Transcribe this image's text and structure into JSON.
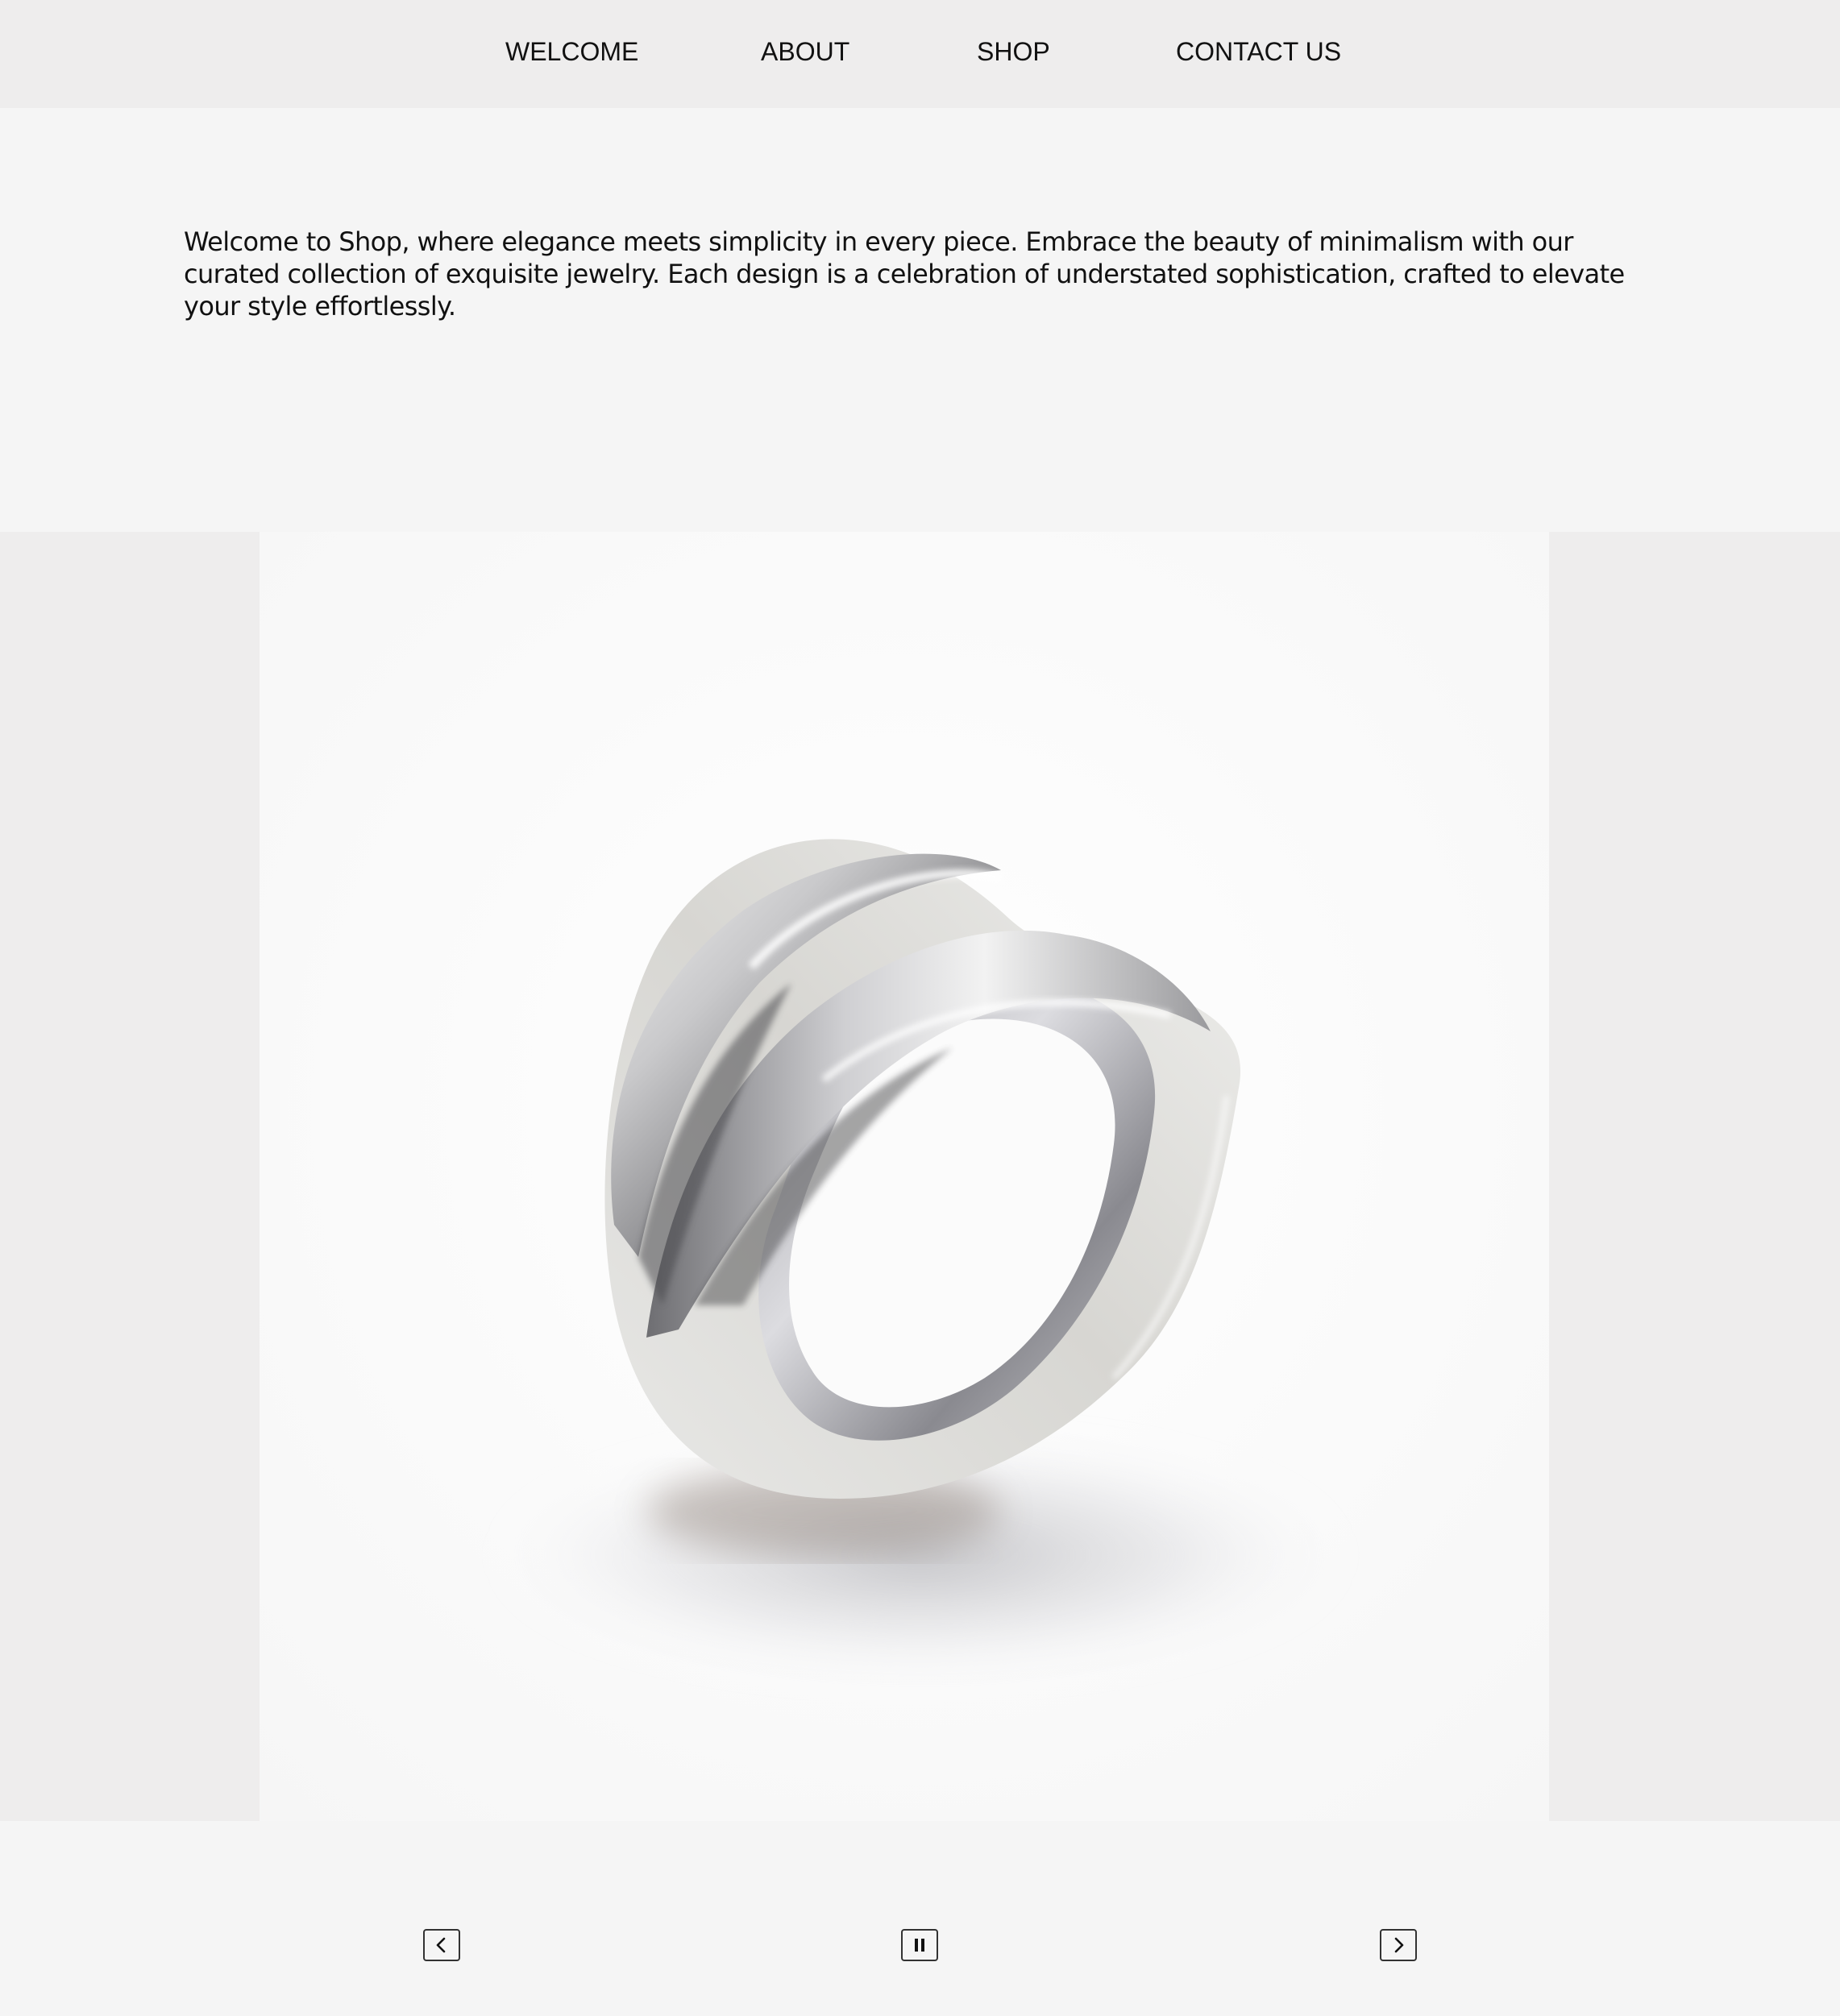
{
  "nav": {
    "items": [
      {
        "label": "WELCOME"
      },
      {
        "label": "ABOUT"
      },
      {
        "label": "SHOP"
      },
      {
        "label": "CONTACT US"
      }
    ]
  },
  "intro": {
    "text": "Welcome to Shop, where elegance meets simplicity in every piece. Embrace the beauty of minimalism with our curated collection of exquisite jewelry. Each design is a celebration of understated sophistication, crafted to elevate your style effortlessly."
  },
  "slider": {
    "image": "silver-ring-photo",
    "controls": {
      "prev_icon": "chevron-left-icon",
      "pause_icon": "pause-icon",
      "next_icon": "chevron-right-icon"
    }
  },
  "colors": {
    "nav_background": "#eeeded",
    "page_background": "#f5f5f5",
    "slider_background": "#eeeded",
    "text": "#111111"
  }
}
